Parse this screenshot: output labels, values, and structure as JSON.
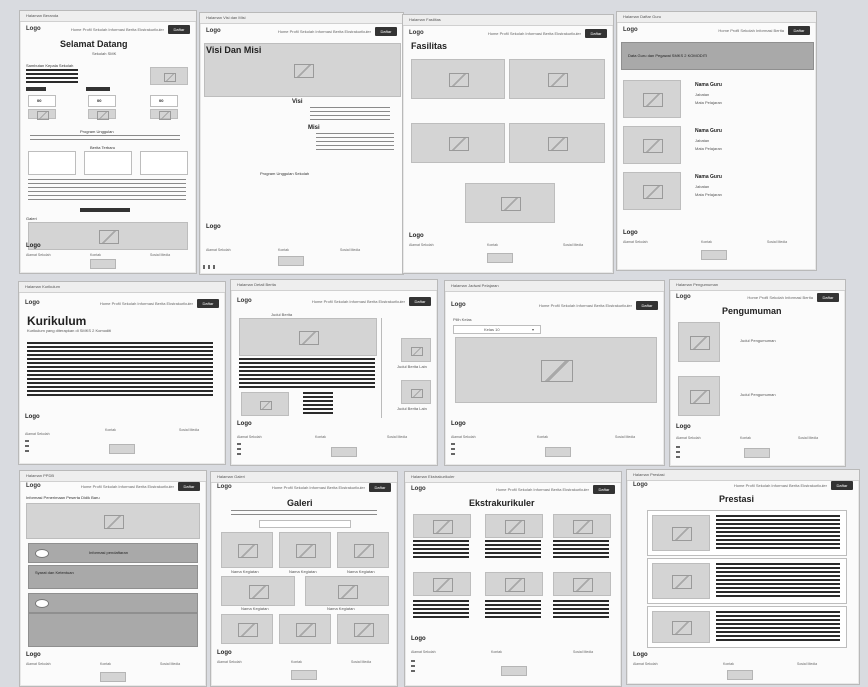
{
  "board": {
    "background": "#d9dbe0"
  },
  "frames": {
    "home": {
      "header": "Halaman Beranda",
      "welcome": "Selamat Datang",
      "subtitle": "Sekolah SMK",
      "logo": "Logo",
      "menu": "Home  Profil Sekolah  Informasi  Berita  Ekstrakurikuler",
      "button": "Daftar",
      "program_heading": "Program Unggulan",
      "news_heading": "Berita Terbaru",
      "gallery_heading": "Galeri"
    },
    "visi": {
      "header": "Halaman Visi dan Misi",
      "logo": "Logo",
      "menu": "Home  Profil Sekolah  Informasi  Berita  Ekstrakurikuler",
      "button": "Daftar",
      "title": "Visi Dan Misi",
      "visi": "Visi",
      "misi": "Misi",
      "program": "Program Unggulan Sekolah",
      "footer_logo": "Logo"
    },
    "fasilitas": {
      "header": "Halaman Fasilitas",
      "logo": "Logo",
      "menu": "Home  Profil Sekolah  Informasi  Berita  Ekstrakurikuler",
      "button": "Daftar",
      "title": "Fasilitas",
      "footer_logo": "Logo"
    },
    "guru": {
      "header": "Halaman Daftar Guru",
      "logo": "Logo",
      "menu": "Home  Profil Sekolah  Informasi  Berita",
      "button": "Daftar",
      "banner": "Data Guru dan Pegawai SMKS 2 KOMODITI",
      "teacher_name": "Nama Guru",
      "teacher_role": "Jabatan",
      "teacher_subject": "Mata Pelajaran",
      "footer_logo": "Logo"
    },
    "kurikulum": {
      "header": "Halaman Kurikulum",
      "logo": "Logo",
      "menu": "Home  Profil Sekolah  Informasi  Berita  Ekstrakurikuler",
      "button": "Daftar",
      "title": "Kurikulum",
      "subtitle": "Kurikulum yang diterapkan di SMKS 2 Komoditi",
      "footer_logo": "Logo"
    },
    "berita": {
      "header": "Halaman Detail Berita",
      "logo": "Logo",
      "menu": "Home  Profil Sekolah  Informasi  Berita  Ekstrakurikuler",
      "button": "Daftar",
      "news_title": "Judul Berita",
      "related": "Judul Berita Lain",
      "footer_logo": "Logo"
    },
    "jadwal": {
      "header": "Halaman Jadwal Pelajaran",
      "logo": "Logo",
      "menu": "Home  Profil Sekolah  Informasi  Berita  Ekstrakurikuler",
      "button": "Daftar",
      "select_label": "Pilih Kelas",
      "select_value": "Kelas 10",
      "footer_logo": "Logo"
    },
    "pengumuman": {
      "header": "Halaman Pengumuman",
      "logo": "Logo",
      "menu": "Home  Profil Sekolah  Informasi  Berita",
      "button": "Daftar",
      "title": "Pengumuman",
      "item_text": "Judul Pengumuman",
      "footer_logo": "Logo"
    },
    "ppdb": {
      "header": "Halaman PPDB",
      "logo": "Logo",
      "menu": "Home  Profil Sekolah  Informasi  Berita  Ekstrakurikuler",
      "button": "Daftar",
      "heading": "Informasi Penerimaan Peserta Didik Baru",
      "block1": "Informasi pendaftaran",
      "block2": "Syarat dan Ketentuan",
      "footer_logo": "Logo"
    },
    "galeri": {
      "header": "Halaman Galeri",
      "logo": "Logo",
      "menu": "Home  Profil Sekolah  Informasi  Berita  Ekstrakurikuler",
      "button": "Daftar",
      "title": "Galeri",
      "caption": "Nama Kegiatan",
      "footer_logo": "Logo"
    },
    "ekskul": {
      "header": "Halaman Ekstrakurikuler",
      "logo": "Logo",
      "menu": "Home  Profil Sekolah  Informasi  Berita  Ekstrakurikuler",
      "button": "Daftar",
      "title": "Ekstrakurikuler",
      "item": "Ekstrakurikuler",
      "footer_logo": "Logo"
    },
    "prestasi": {
      "header": "Halaman Prestasi",
      "logo": "Logo",
      "menu": "Home  Profil Sekolah  Informasi  Berita  Ekstrakurikuler",
      "button": "Daftar",
      "title": "Prestasi",
      "footer_logo": "Logo"
    }
  },
  "footer": {
    "col1": "Alamat Sekolah",
    "col2": "Kontak",
    "col3": "Sosial Media"
  }
}
